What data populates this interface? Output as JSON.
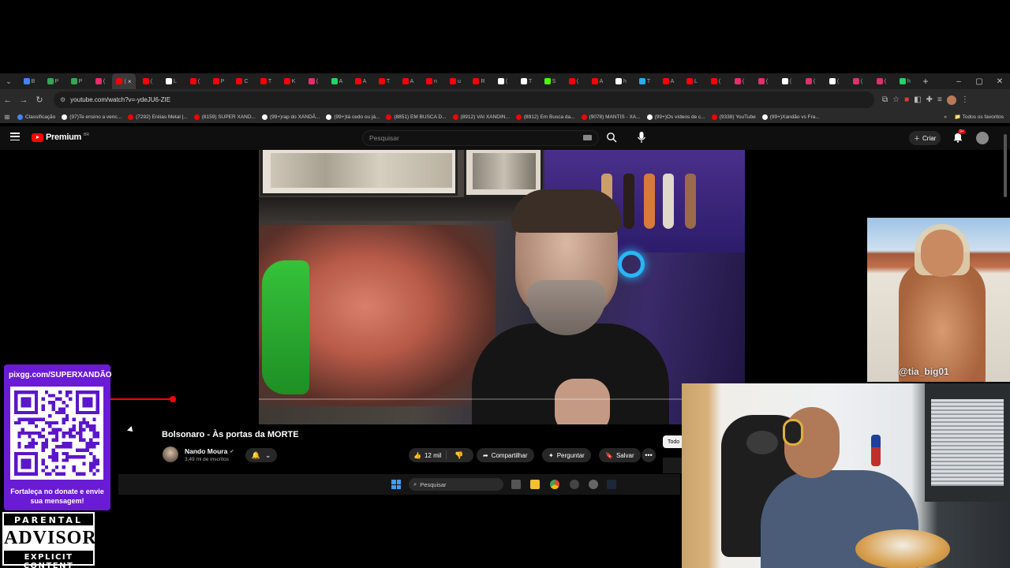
{
  "browser": {
    "tabs": [
      {
        "label": "B",
        "color": "#4285f4"
      },
      {
        "label": "P",
        "color": "#34a853"
      },
      {
        "label": "P",
        "color": "#34a853"
      },
      {
        "label": "(",
        "color": "#e1306c"
      },
      {
        "label": "(",
        "color": "#ff0000",
        "active": true
      },
      {
        "label": "(",
        "color": "#ff0000"
      },
      {
        "label": "L",
        "color": "#ffffff"
      },
      {
        "label": "(",
        "color": "#ff0000"
      },
      {
        "label": "P",
        "color": "#ff0000"
      },
      {
        "label": "C",
        "color": "#ff0000"
      },
      {
        "label": "T",
        "color": "#ff0000"
      },
      {
        "label": "K",
        "color": "#ff0000"
      },
      {
        "label": "(",
        "color": "#e1306c"
      },
      {
        "label": "A",
        "color": "#25d366"
      },
      {
        "label": "A",
        "color": "#ff0000"
      },
      {
        "label": "T",
        "color": "#ff0000"
      },
      {
        "label": "A",
        "color": "#ff0000"
      },
      {
        "label": "n",
        "color": "#ff0000"
      },
      {
        "label": "u",
        "color": "#ff0000"
      },
      {
        "label": "R",
        "color": "#ff0000"
      },
      {
        "label": "(",
        "color": "#ffffff"
      },
      {
        "label": "T",
        "color": "#ffffff"
      },
      {
        "label": "S",
        "color": "#53fc18"
      },
      {
        "label": "(",
        "color": "#ff0000"
      },
      {
        "label": "A",
        "color": "#ff0000"
      },
      {
        "label": "h",
        "color": "#ffffff"
      },
      {
        "label": "T",
        "color": "#2aabee"
      },
      {
        "label": "A",
        "color": "#ff0000"
      },
      {
        "label": "L",
        "color": "#ff0000"
      },
      {
        "label": "(",
        "color": "#ff0000"
      },
      {
        "label": "(",
        "color": "#e1306c"
      },
      {
        "label": "(",
        "color": "#e1306c"
      },
      {
        "label": "(",
        "color": "#ffffff"
      },
      {
        "label": "(",
        "color": "#e1306c"
      },
      {
        "label": "(",
        "color": "#ffffff"
      },
      {
        "label": "(",
        "color": "#e1306c"
      },
      {
        "label": "(",
        "color": "#e1306c"
      },
      {
        "label": "h",
        "color": "#25d366"
      }
    ],
    "close_glyph": "×",
    "new_tab_glyph": "+",
    "url": "youtube.com/watch?v=-ydeJU6-ZIE",
    "bookmarks": [
      {
        "label": "Classificação",
        "color": "#4285f4"
      },
      {
        "label": "(97)Te ensino a venc...",
        "color": "#ffffff"
      },
      {
        "label": "(7292) Eréias Metal |...",
        "color": "#ff0000"
      },
      {
        "label": "(8159) SUPER XAND...",
        "color": "#ff0000"
      },
      {
        "label": "(99+)rap do XANDÃ...",
        "color": "#ffffff"
      },
      {
        "label": "(99+)tá cedo ou já...",
        "color": "#ffffff"
      },
      {
        "label": "(8851) EM BUSCA D...",
        "color": "#ff0000"
      },
      {
        "label": "(8912) VAI XANDIN...",
        "color": "#ff0000"
      },
      {
        "label": "(8912) Em Busca da...",
        "color": "#ff0000"
      },
      {
        "label": "(9078) MANTIS - XA...",
        "color": "#ff0000"
      },
      {
        "label": "(99+)Os vídeos de c...",
        "color": "#ffffff"
      },
      {
        "label": "(9338) YouTube",
        "color": "#ff0000"
      },
      {
        "label": "(99+)Xandão vs Fra...",
        "color": "#ffffff"
      }
    ],
    "all_bookmarks": "Todos os favoritos"
  },
  "youtube": {
    "logo_text": "Premium",
    "logo_country": "BR",
    "search_placeholder": "Pesquisar",
    "create_label": "Criar",
    "notifications_badge": "9+",
    "video": {
      "title": "Bolsonaro - Às portas da MORTE",
      "progress": 0.18
    },
    "channel": {
      "name": "Nando Moura",
      "verified_glyph": "✔",
      "subscribers": "3,49 mi de inscritos"
    },
    "actions": {
      "likes": "12 mil",
      "share": "Compartilhar",
      "ask": "Perguntar",
      "save": "Salvar",
      "more": "•••"
    },
    "chip": "Todo"
  },
  "taskbar": {
    "search_placeholder": "Pesquisar"
  },
  "overlays": {
    "donation_url": "pixgg.com/SUPERXANDÃO",
    "donation_message": "Fortaleça no donate e envie sua mensagem!",
    "advisory_top": "PARENTAL",
    "advisory_mid": "ADVISORY",
    "advisory_bottom": "EXPLICIT CONTENT",
    "meme_tag": "@tia_big01"
  },
  "colors": {
    "youtube_red": "#ff0000",
    "qr_card_bg": "#6a1bd4",
    "page_bg": "#0f0f0f"
  }
}
